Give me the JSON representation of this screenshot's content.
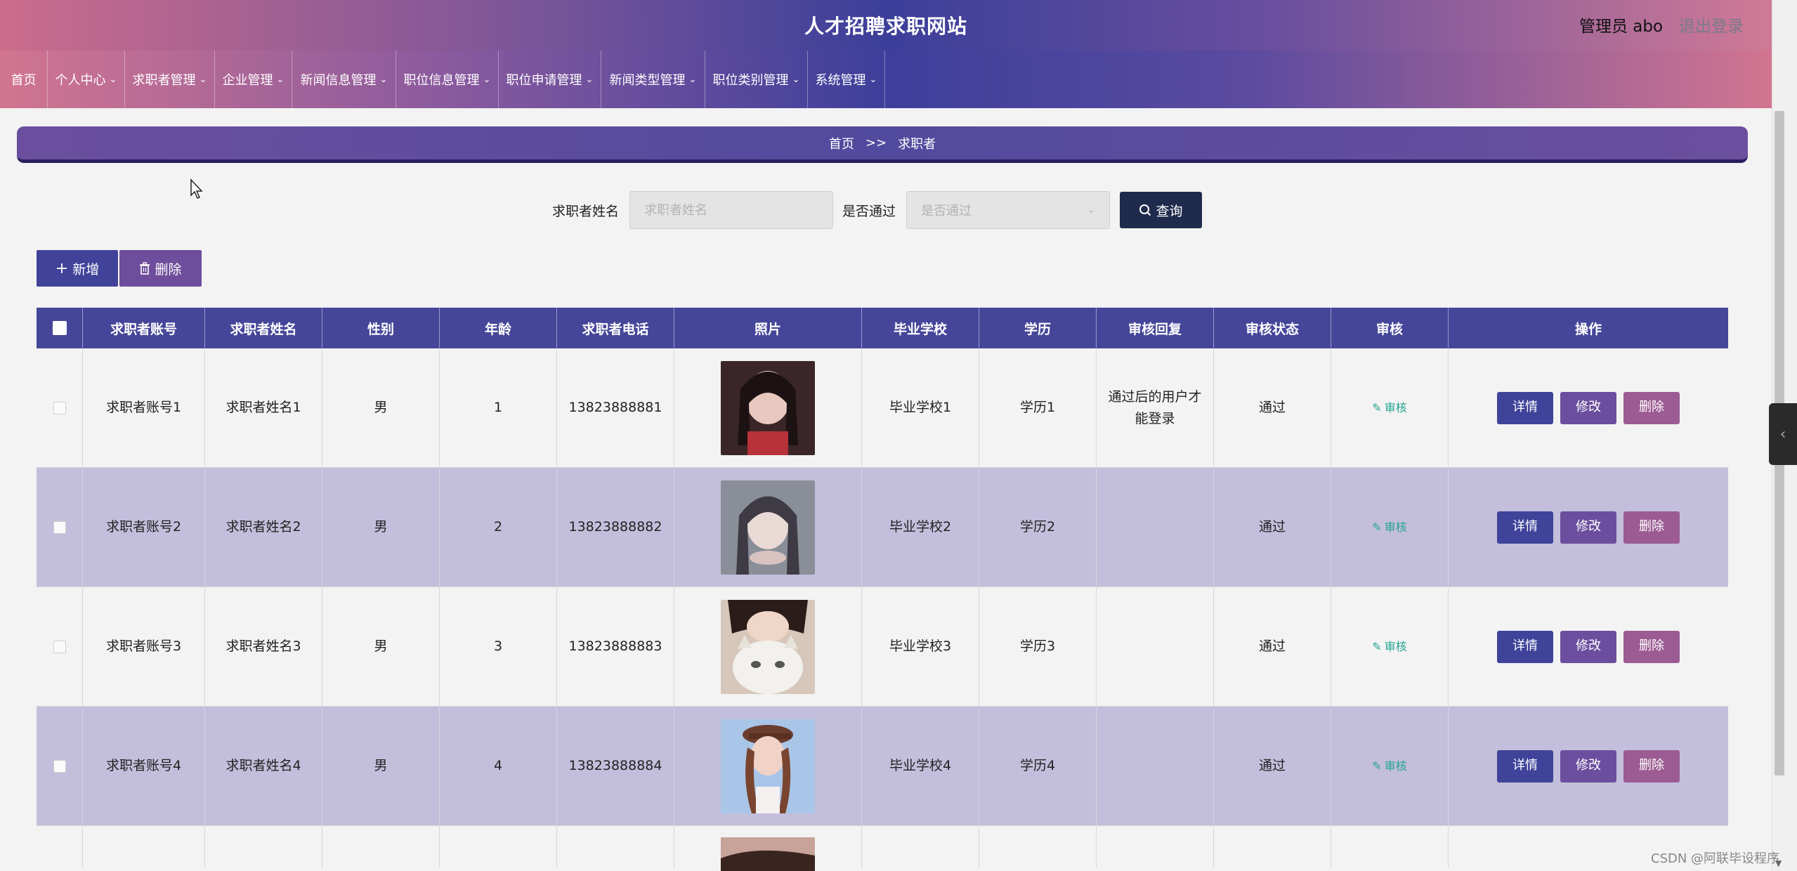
{
  "header": {
    "site_title": "人才招聘求职网站",
    "admin_label": "管理员 abo",
    "logout": "退出登录"
  },
  "nav": {
    "items": [
      {
        "label": "首页",
        "dropdown": false
      },
      {
        "label": "个人中心",
        "dropdown": true
      },
      {
        "label": "求职者管理",
        "dropdown": true
      },
      {
        "label": "企业管理",
        "dropdown": true
      },
      {
        "label": "新闻信息管理",
        "dropdown": true
      },
      {
        "label": "职位信息管理",
        "dropdown": true
      },
      {
        "label": "职位申请管理",
        "dropdown": true
      },
      {
        "label": "新闻类型管理",
        "dropdown": true
      },
      {
        "label": "职位类别管理",
        "dropdown": true
      },
      {
        "label": "系统管理",
        "dropdown": true
      }
    ]
  },
  "breadcrumb": {
    "home": "首页",
    "separator": ">>",
    "current": "求职者"
  },
  "search": {
    "name_label": "求职者姓名",
    "name_placeholder": "求职者姓名",
    "pass_label": "是否通过",
    "pass_placeholder": "是否通过",
    "query_button": "查询"
  },
  "actions": {
    "add": "新增",
    "delete": "删除"
  },
  "table": {
    "headers": [
      "求职者账号",
      "求职者姓名",
      "性别",
      "年龄",
      "求职者电话",
      "照片",
      "毕业学校",
      "学历",
      "审核回复",
      "审核状态",
      "审核",
      "操作"
    ],
    "review_link": "审核",
    "op_detail": "详情",
    "op_edit": "修改",
    "op_delete": "删除",
    "rows": [
      {
        "account": "求职者账号1",
        "name": "求职者姓名1",
        "gender": "男",
        "age": "1",
        "phone": "13823888881",
        "school": "毕业学校1",
        "degree": "学历1",
        "reply": "通过后的用户才能登录",
        "status": "通过"
      },
      {
        "account": "求职者账号2",
        "name": "求职者姓名2",
        "gender": "男",
        "age": "2",
        "phone": "13823888882",
        "school": "毕业学校2",
        "degree": "学历2",
        "reply": "",
        "status": "通过"
      },
      {
        "account": "求职者账号3",
        "name": "求职者姓名3",
        "gender": "男",
        "age": "3",
        "phone": "13823888883",
        "school": "毕业学校3",
        "degree": "学历3",
        "reply": "",
        "status": "通过"
      },
      {
        "account": "求职者账号4",
        "name": "求职者姓名4",
        "gender": "男",
        "age": "4",
        "phone": "13823888884",
        "school": "毕业学校4",
        "degree": "学历4",
        "reply": "",
        "status": "通过"
      }
    ]
  },
  "watermark": "CSDN @阿联毕设程序"
}
